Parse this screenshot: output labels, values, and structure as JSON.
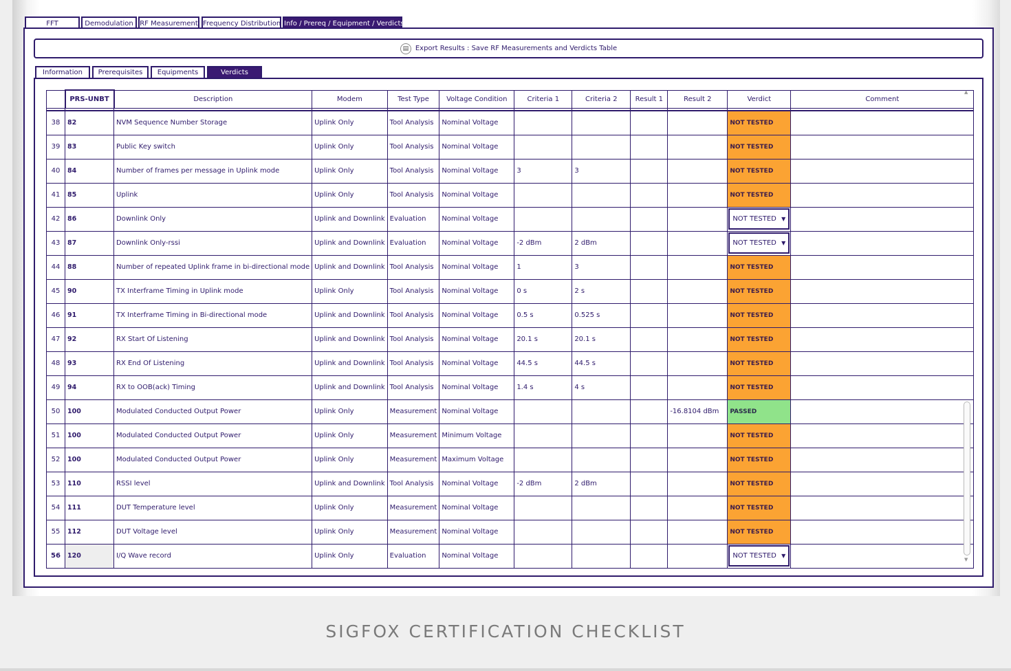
{
  "main_tabs": [
    "FFT",
    "Demodulation",
    "RF Measurement",
    "Frequency Distribution",
    "Info / Prereq / Equipment / Verdicts"
  ],
  "active_main_tab": "Info / Prereq / Equipment / Verdicts",
  "export": {
    "icon": "document-export-icon",
    "label": "Export Results : Save RF Measurements and Verdicts Table"
  },
  "sub_tabs": [
    "Information",
    "Prerequisites",
    "Equipments",
    "Verdicts"
  ],
  "active_sub_tab": "Verdicts",
  "table": {
    "headers": [
      "",
      "PRS-UNBT",
      "Description",
      "Modem",
      "Test Type",
      "Voltage Condition",
      "Criteria 1",
      "Criteria 2",
      "Result 1",
      "Result 2",
      "Verdict",
      "Comment"
    ],
    "rows": [
      {
        "n": "38",
        "prs": "82",
        "desc": "NVM Sequence Number Storage",
        "modem": "Uplink Only",
        "type": "Tool Analysis",
        "voltage": "Nominal Voltage",
        "c1": "",
        "c2": "",
        "r1": "",
        "r2": "",
        "verdict": "NOT TESTED",
        "style": "orange",
        "comment": ""
      },
      {
        "n": "39",
        "prs": "83",
        "desc": "Public Key switch",
        "modem": "Uplink Only",
        "type": "Tool Analysis",
        "voltage": "Nominal Voltage",
        "c1": "",
        "c2": "",
        "r1": "",
        "r2": "",
        "verdict": "NOT TESTED",
        "style": "orange",
        "comment": ""
      },
      {
        "n": "40",
        "prs": "84",
        "desc": "Number of frames per message in Uplink mode",
        "modem": "Uplink Only",
        "type": "Tool Analysis",
        "voltage": "Nominal Voltage",
        "c1": "3",
        "c2": "3",
        "r1": "",
        "r2": "",
        "verdict": "NOT TESTED",
        "style": "orange",
        "comment": ""
      },
      {
        "n": "41",
        "prs": "85",
        "desc": "Uplink",
        "modem": "Uplink Only",
        "type": "Tool Analysis",
        "voltage": "Nominal Voltage",
        "c1": "",
        "c2": "",
        "r1": "",
        "r2": "",
        "verdict": "NOT TESTED",
        "style": "orange",
        "comment": ""
      },
      {
        "n": "42",
        "prs": "86",
        "desc": "Downlink Only",
        "modem": "Uplink and Downlink",
        "type": "Evaluation",
        "voltage": "Nominal Voltage",
        "c1": "",
        "c2": "",
        "r1": "",
        "r2": "",
        "verdict": "NOT TESTED",
        "style": "dropdown",
        "comment": ""
      },
      {
        "n": "43",
        "prs": "87",
        "desc": "Downlink Only-rssi",
        "modem": "Uplink and Downlink",
        "type": "Evaluation",
        "voltage": "Nominal Voltage",
        "c1": "-2 dBm",
        "c2": "2 dBm",
        "r1": "",
        "r2": "",
        "verdict": "NOT TESTED",
        "style": "dropdown",
        "comment": ""
      },
      {
        "n": "44",
        "prs": "88",
        "desc": "Number of repeated Uplink frame in bi-directional mode",
        "modem": "Uplink and Downlink",
        "type": "Tool Analysis",
        "voltage": "Nominal Voltage",
        "c1": "1",
        "c2": "3",
        "r1": "",
        "r2": "",
        "verdict": "NOT TESTED",
        "style": "orange",
        "comment": ""
      },
      {
        "n": "45",
        "prs": "90",
        "desc": "TX Interframe Timing in Uplink mode",
        "modem": "Uplink Only",
        "type": "Tool Analysis",
        "voltage": "Nominal Voltage",
        "c1": "0 s",
        "c2": "2 s",
        "r1": "",
        "r2": "",
        "verdict": "NOT TESTED",
        "style": "orange",
        "comment": ""
      },
      {
        "n": "46",
        "prs": "91",
        "desc": "TX Interframe Timing in Bi-directional mode",
        "modem": "Uplink and Downlink",
        "type": "Tool Analysis",
        "voltage": "Nominal Voltage",
        "c1": "0.5 s",
        "c2": "0.525 s",
        "r1": "",
        "r2": "",
        "verdict": "NOT TESTED",
        "style": "orange",
        "comment": ""
      },
      {
        "n": "47",
        "prs": "92",
        "desc": "RX Start Of Listening",
        "modem": "Uplink and Downlink",
        "type": "Tool Analysis",
        "voltage": "Nominal Voltage",
        "c1": "20.1 s",
        "c2": "20.1 s",
        "r1": "",
        "r2": "",
        "verdict": "NOT TESTED",
        "style": "orange",
        "comment": ""
      },
      {
        "n": "48",
        "prs": "93",
        "desc": "RX End Of Listening",
        "modem": "Uplink and Downlink",
        "type": "Tool Analysis",
        "voltage": "Nominal Voltage",
        "c1": "44.5 s",
        "c2": "44.5 s",
        "r1": "",
        "r2": "",
        "verdict": "NOT TESTED",
        "style": "orange",
        "comment": ""
      },
      {
        "n": "49",
        "prs": "94",
        "desc": "RX to OOB(ack) Timing",
        "modem": "Uplink and Downlink",
        "type": "Tool Analysis",
        "voltage": "Nominal Voltage",
        "c1": "1.4 s",
        "c2": "4 s",
        "r1": "",
        "r2": "",
        "verdict": "NOT TESTED",
        "style": "orange",
        "comment": ""
      },
      {
        "n": "50",
        "prs": "100",
        "desc": "Modulated Conducted Output Power",
        "modem": "Uplink Only",
        "type": "Measurement",
        "voltage": "Nominal Voltage",
        "c1": "",
        "c2": "",
        "r1": "",
        "r2": "-16.8104 dBm",
        "verdict": "PASSED",
        "style": "green",
        "comment": ""
      },
      {
        "n": "51",
        "prs": "100",
        "desc": "Modulated Conducted Output Power",
        "modem": "Uplink Only",
        "type": "Measurement",
        "voltage": "Minimum Voltage",
        "c1": "",
        "c2": "",
        "r1": "",
        "r2": "",
        "verdict": "NOT TESTED",
        "style": "orange",
        "comment": ""
      },
      {
        "n": "52",
        "prs": "100",
        "desc": "Modulated Conducted Output Power",
        "modem": "Uplink Only",
        "type": "Measurement",
        "voltage": "Maximum Voltage",
        "c1": "",
        "c2": "",
        "r1": "",
        "r2": "",
        "verdict": "NOT TESTED",
        "style": "orange",
        "comment": ""
      },
      {
        "n": "53",
        "prs": "110",
        "desc": "RSSI level",
        "modem": "Uplink and Downlink",
        "type": "Tool Analysis",
        "voltage": "Nominal Voltage",
        "c1": "-2 dBm",
        "c2": "2 dBm",
        "r1": "",
        "r2": "",
        "verdict": "NOT TESTED",
        "style": "orange",
        "comment": ""
      },
      {
        "n": "54",
        "prs": "111",
        "desc": "DUT Temperature level",
        "modem": "Uplink Only",
        "type": "Measurement",
        "voltage": "Nominal Voltage",
        "c1": "",
        "c2": "",
        "r1": "",
        "r2": "",
        "verdict": "NOT TESTED",
        "style": "orange",
        "comment": ""
      },
      {
        "n": "55",
        "prs": "112",
        "desc": "DUT Voltage level",
        "modem": "Uplink Only",
        "type": "Measurement",
        "voltage": "Nominal Voltage",
        "c1": "",
        "c2": "",
        "r1": "",
        "r2": "",
        "verdict": "NOT TESTED",
        "style": "orange",
        "comment": ""
      },
      {
        "n": "56",
        "prs": "120",
        "desc": "I/Q Wave record",
        "modem": "Uplink Only",
        "type": "Evaluation",
        "voltage": "Nominal Voltage",
        "c1": "",
        "c2": "",
        "r1": "",
        "r2": "",
        "verdict": "NOT TESTED",
        "style": "dropdown",
        "comment": "",
        "selected": true
      }
    ]
  },
  "colors": {
    "accent": "#2e1a6b",
    "not_tested": "#fba333",
    "passed": "#90e38a"
  },
  "caption": "SIGFOX CERTIFICATION CHECKLIST"
}
